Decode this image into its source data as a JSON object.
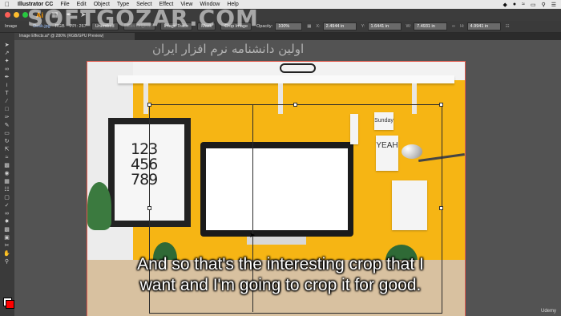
{
  "menubar": {
    "app_name": "Illustrator CC",
    "items": [
      "File",
      "Edit",
      "Object",
      "Type",
      "Select",
      "Effect",
      "View",
      "Window",
      "Help"
    ]
  },
  "appbar": {
    "logo": "Ai"
  },
  "control_bar": {
    "mode_label": "Image",
    "file_name": "Desk.jpg",
    "color_mode": "RGB",
    "ppi": "PPI: 267",
    "embed_btn": "Unembed",
    "edit_original_btn": "Edit Original",
    "image_trace_btn": "Image Trace",
    "mask_btn": "Mask",
    "crop_image_btn": "Crop Image",
    "opacity_label": "Opacity:",
    "opacity_value": "100%",
    "x_label": "X:",
    "x_value": "2.4944 in",
    "y_label": "Y:",
    "y_value": "1.6441 in",
    "w_label": "W:",
    "w_value": "7.4931 in",
    "h_label": "H:",
    "h_value": "4.9941 in"
  },
  "document_tab": {
    "title": "Image Effects.ai* @ 280% (RGB/GPU Preview)"
  },
  "watermark": {
    "text": "SOFTGOZAR.COM",
    "persian": "اولین دانشنامه نرم افزار ایران"
  },
  "poster": {
    "numbers": [
      "123",
      "456",
      "789"
    ]
  },
  "notes": {
    "sunday": "Sunday",
    "yeah": "YEAH"
  },
  "subtitle": {
    "line1": "And so that's the interesting crop that I",
    "line2": "want and I'm going to crop it for good."
  },
  "branding": {
    "udemy": "Udemy"
  },
  "colors": {
    "artboard_border": "#e25b4d",
    "wall": "#f6b514",
    "illustrator_orange": "#ff9a00"
  }
}
